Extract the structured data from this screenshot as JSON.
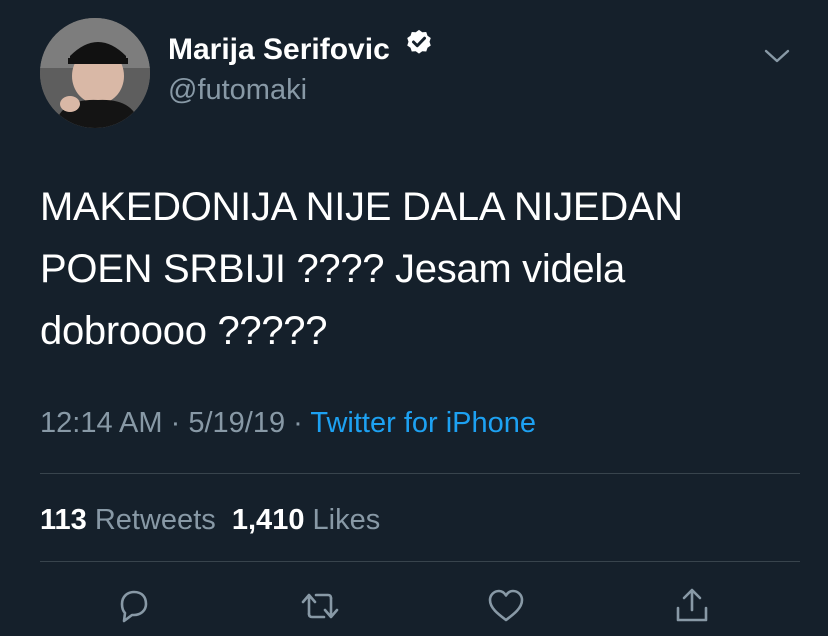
{
  "user": {
    "name": "Marija Serifovic",
    "handle": "@futomaki",
    "verified": true
  },
  "tweet": {
    "lines": [
      "MAKEDONIJA NIJE DALA NIJEDAN",
      "POEN SRBIJI ???? Jesam videla",
      "dobroooo ?????"
    ],
    "time": "12:14 AM",
    "date": "5/19/19",
    "separator": "·",
    "source": "Twitter for iPhone"
  },
  "stats": {
    "retweets_count": "113",
    "retweets_label": "Retweets",
    "likes_count": "1,410",
    "likes_label": "Likes"
  },
  "icons": {
    "caret": "chevron-down-icon",
    "verified": "verified-badge-icon",
    "reply": "reply-icon",
    "retweet": "retweet-icon",
    "like": "heart-icon",
    "share": "share-icon"
  },
  "colors": {
    "background": "#15202b",
    "primary_text": "#ffffff",
    "secondary_text": "#8899a6",
    "accent": "#1da1f2",
    "divider": "#38444d"
  }
}
